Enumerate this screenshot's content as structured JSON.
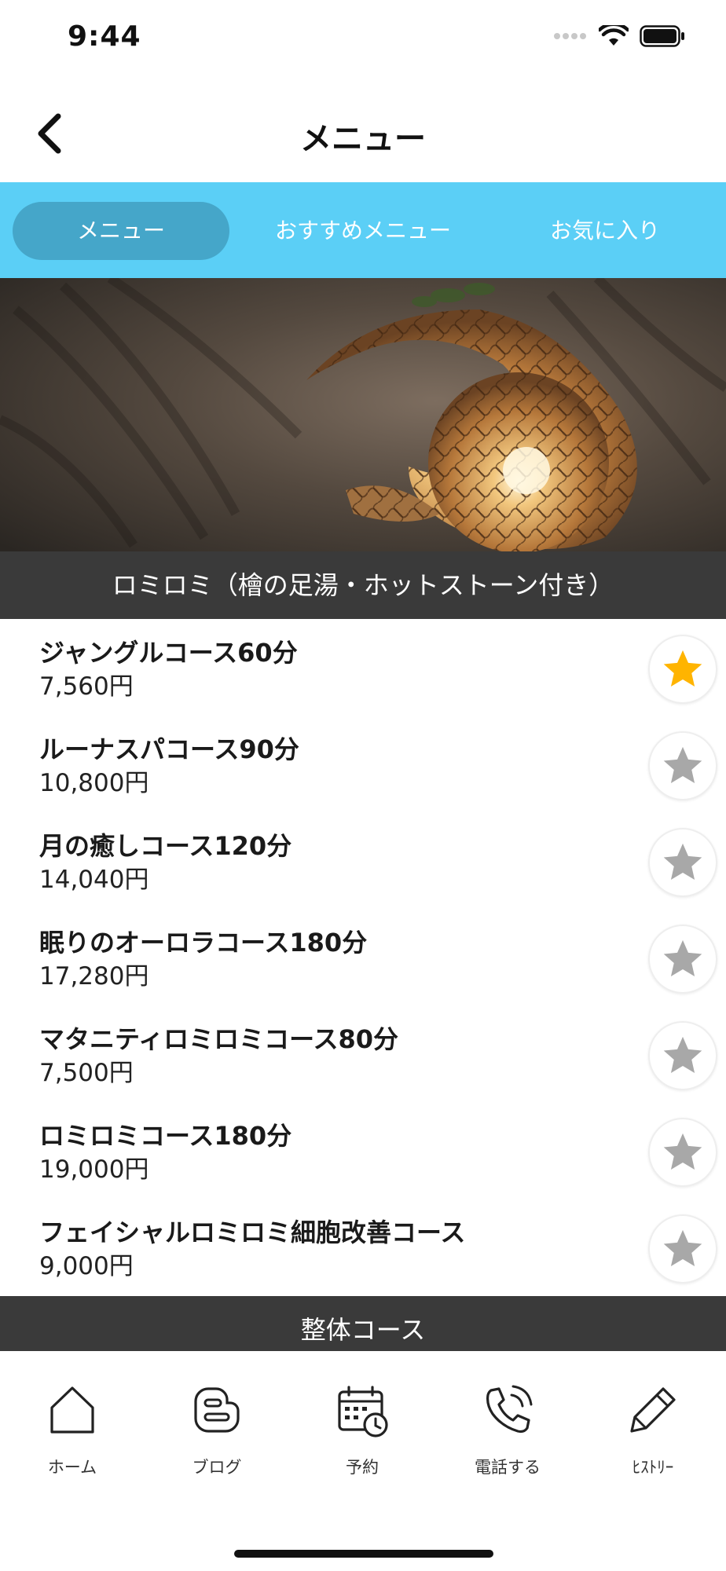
{
  "status_bar": {
    "time": "9:44"
  },
  "header": {
    "title": "メニュー"
  },
  "tabs": [
    {
      "label": "メニュー",
      "active": true
    },
    {
      "label": "おすすめメニュー",
      "active": false
    },
    {
      "label": "お気に入り",
      "active": false
    }
  ],
  "sections": [
    {
      "title": "ロミロミ（檜の足湯・ホットストーン付き）"
    },
    {
      "title": "整体コース"
    }
  ],
  "menu_items": [
    {
      "name": "ジャングルコース60分",
      "price": "7,560円",
      "favorite": true
    },
    {
      "name": "ルーナスパコース90分",
      "price": "10,800円",
      "favorite": false
    },
    {
      "name": "月の癒しコース120分",
      "price": "14,040円",
      "favorite": false
    },
    {
      "name": "眠りのオーロラコース180分",
      "price": "17,280円",
      "favorite": false
    },
    {
      "name": "マタニティロミロミコース80分",
      "price": "7,500円",
      "favorite": false
    },
    {
      "name": "ロミロミコース180分",
      "price": "19,000円",
      "favorite": false
    },
    {
      "name": "フェイシャルロミロミ細胞改善コース",
      "price": "9,000円",
      "favorite": false
    }
  ],
  "tab_bar": [
    {
      "label": "ホーム",
      "icon": "home-icon"
    },
    {
      "label": "ブログ",
      "icon": "blog-icon"
    },
    {
      "label": "予約",
      "icon": "calendar-icon"
    },
    {
      "label": "電話する",
      "icon": "phone-icon"
    },
    {
      "label": "ﾋｽﾄﾘｰ",
      "icon": "pencil-icon"
    }
  ],
  "colors": {
    "tab_bg": "#5bcff6",
    "tab_active": "#45a6c9",
    "section_bg": "#3a3a3a",
    "star_active": "#ffb400",
    "star_inactive": "#a8a8a8"
  }
}
